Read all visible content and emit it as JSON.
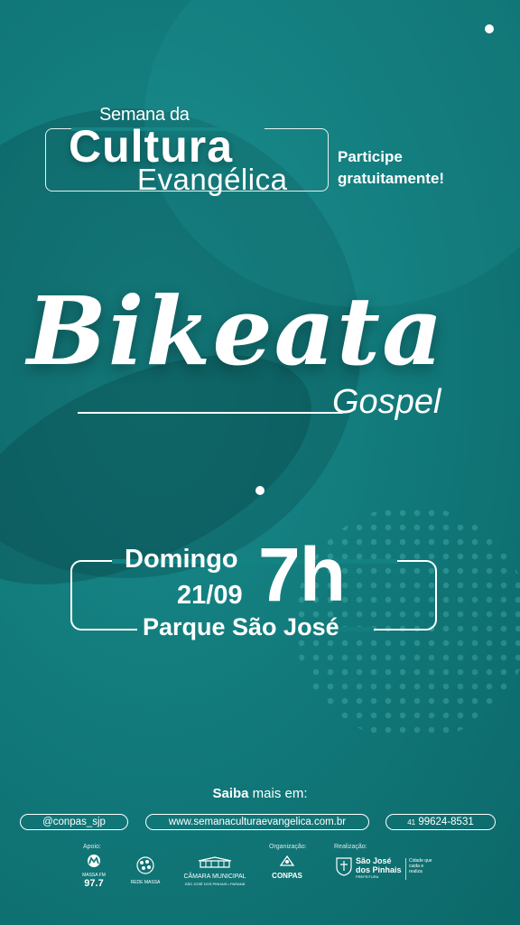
{
  "event": {
    "pretitle": "Semana da",
    "main": "Cultura",
    "sub": "Evangélica",
    "cta_line1": "Participe",
    "cta_line2": "gratuitamente!"
  },
  "activity": {
    "title": "Bikeata",
    "subtitle": "Gospel"
  },
  "schedule": {
    "day": "Domingo",
    "date": "21/09",
    "time": "7h",
    "venue": "Parque São José"
  },
  "contact": {
    "more_bold": "Saiba",
    "more_rest": " mais em:",
    "instagram": "@conpas_sjp",
    "website": "www.semanaculturaevangelica.com.br",
    "phone_ddd": "41",
    "phone": "99624-8531"
  },
  "footer": {
    "support_label": "Apoio:",
    "org_label": "Organização:",
    "realization_label": "Realização:",
    "radio_freq": "97.7",
    "radio_name": "MASSA FM",
    "rede_massa": "REDE MASSA",
    "camara": "CÂMARA MUNICIPAL",
    "camara_sub": "SÃO JOSÉ DOS PINHAIS • PARANÁ",
    "conpas": "CONPAS",
    "sjp_line1": "São José",
    "sjp_line2": "dos Pinhais",
    "sjp_line3": "PREFEITURA",
    "slogan": "Cidade que cuida e realiza"
  },
  "colors": {
    "background": "#127a7b",
    "text": "#ffffff"
  }
}
